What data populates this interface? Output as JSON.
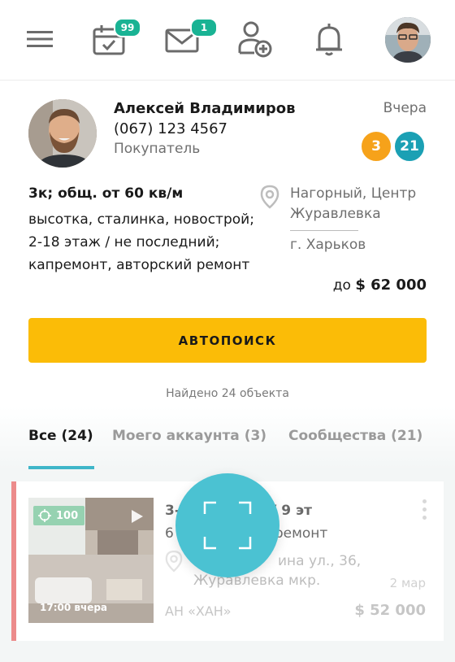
{
  "topbar": {
    "calendar_badge": "99",
    "mail_badge": "1"
  },
  "client": {
    "name": "Алексей Владимиров",
    "phone": "(067) 123 4567",
    "role": "Покупатель",
    "date": "Вчера",
    "count_orange": "3",
    "count_teal": "21"
  },
  "request": {
    "title": "3к; общ. от 60 кв/м",
    "details": "высотка, сталинка, новострой; 2-18 этаж / не последний;  капремонт, авторский ремонт",
    "location_line1": "Нагорный, Центр",
    "location_line2": "Журавлевка",
    "city": "г. Харьков",
    "price_prefix": "до",
    "price_value": "$ 62 000"
  },
  "autosearch_label": "АВТОПОИСК",
  "found_text": "Найдено 24 объекта",
  "tabs": [
    {
      "label": "Все (24)"
    },
    {
      "label": "Моего аккаунта (3)"
    },
    {
      "label": "Сообщества (21)"
    }
  ],
  "listing": {
    "score": "100",
    "thumb_time": "17:00 вчера",
    "title": "3-к",
    "title_tail": "4 / 9 эт",
    "sub": "6",
    "sub_tail": "ремонт",
    "address_line1": "Нагорный р-н, Бакулина ул., 36,",
    "address_line1_visible": "ина ул., 36,",
    "address_line2": "Журавлевка мкр.",
    "date": "2 мар",
    "agency": "АН «ХАН»",
    "price": "$ 52 000"
  },
  "colors": {
    "accent_teal": "#4bc2d2",
    "badge_green": "#19b394",
    "button_yellow": "#fbbc07",
    "count_orange": "#f6a21a",
    "count_teal": "#1ba0b4",
    "stripe_red": "#ec8b8b"
  },
  "icons": {
    "menu": "hamburger-icon",
    "calendar": "calendar-check-icon",
    "mail": "mail-icon",
    "add_contact": "add-user-icon",
    "bell": "bell-icon",
    "location": "map-pin-icon",
    "fab": "scan-frame-icon"
  }
}
